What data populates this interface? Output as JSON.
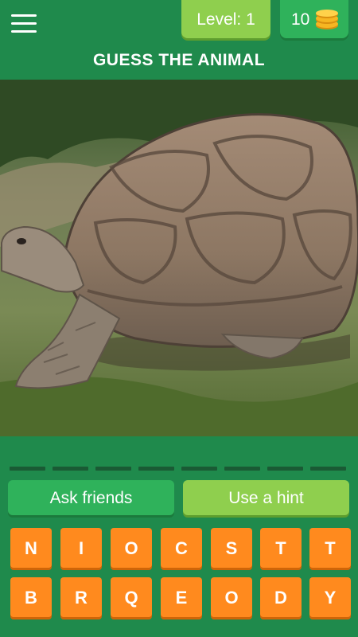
{
  "header": {
    "level_text": "Level: 1",
    "coins": "10"
  },
  "title": "GUESS THE ANIMAL",
  "puzzle": {
    "image_subject": "giant tortoise",
    "answer_slot_count": 8
  },
  "buttons": {
    "ask_friends": "Ask friends",
    "use_hint": "Use a hint"
  },
  "letters": {
    "row1": [
      "N",
      "I",
      "O",
      "C",
      "S",
      "T",
      "T"
    ],
    "row2": [
      "B",
      "R",
      "Q",
      "E",
      "O",
      "D",
      "Y"
    ]
  },
  "colors": {
    "background": "#1f8a4c",
    "level_badge": "#8fcf4e",
    "coins_badge": "#2fb25b",
    "letter_tile": "#ff8a1e",
    "coin": "#f6b622"
  }
}
